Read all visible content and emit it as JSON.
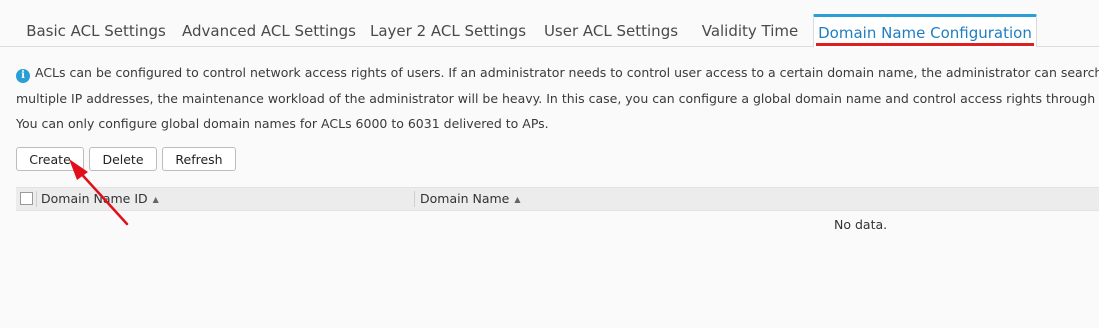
{
  "tabs": [
    {
      "label": "Basic ACL Settings"
    },
    {
      "label": "Advanced ACL Settings"
    },
    {
      "label": "Layer 2 ACL Settings"
    },
    {
      "label": "User ACL Settings"
    },
    {
      "label": "Validity Time"
    },
    {
      "label": "Domain Name Configuration",
      "active": true
    }
  ],
  "info": {
    "icon": "info-icon",
    "line1": "ACLs can be configured to control network access rights of users. If an administrator needs to control user access to a certain domain name, the administrator can search for the IP address matc",
    "line2": "multiple IP addresses, the maintenance workload of the administrator will be heavy. In this case, you can configure a global domain name and control access rights through the global name in ACL",
    "line3": "You can only configure global domain names for ACLs 6000 to 6031 delivered to APs."
  },
  "toolbar": {
    "create_label": "Create",
    "delete_label": "Delete",
    "refresh_label": "Refresh"
  },
  "table": {
    "columns": [
      "Domain Name ID",
      "Domain Name"
    ],
    "sort_icon": "▲",
    "empty_text": "No data."
  },
  "annotation": {
    "arrow_color": "#e0101a",
    "underline_color": "#e02020"
  },
  "colors": {
    "accent": "#2a9fd6",
    "active_tab_text": "#1f7ec2"
  }
}
